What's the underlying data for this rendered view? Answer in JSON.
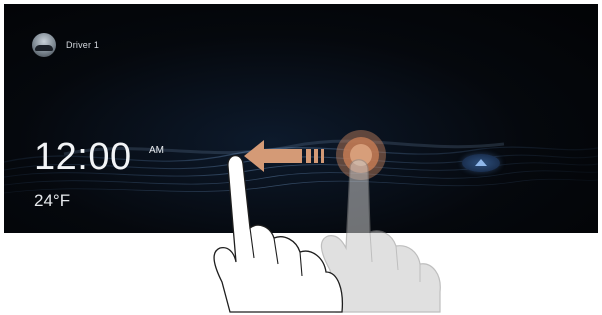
{
  "profile": {
    "driver_label": "Driver 1"
  },
  "clock": {
    "time": "12:00",
    "meridiem": "AM"
  },
  "weather": {
    "temperature": "24°F"
  },
  "icons": {
    "avatar": "driver-avatar-icon",
    "nav": "navigation-arrow-icon",
    "gesture_arrow": "swipe-left-arrow-icon",
    "touch_point": "touch-point-icon",
    "hand": "hand-pointer-icon"
  },
  "colors": {
    "screen_bg": "#05080d",
    "wave": "#3b5f8a",
    "gesture_arrow": "#d49a76",
    "touch_point": "#c9865f",
    "nav_accent": "#5f8fd0"
  }
}
